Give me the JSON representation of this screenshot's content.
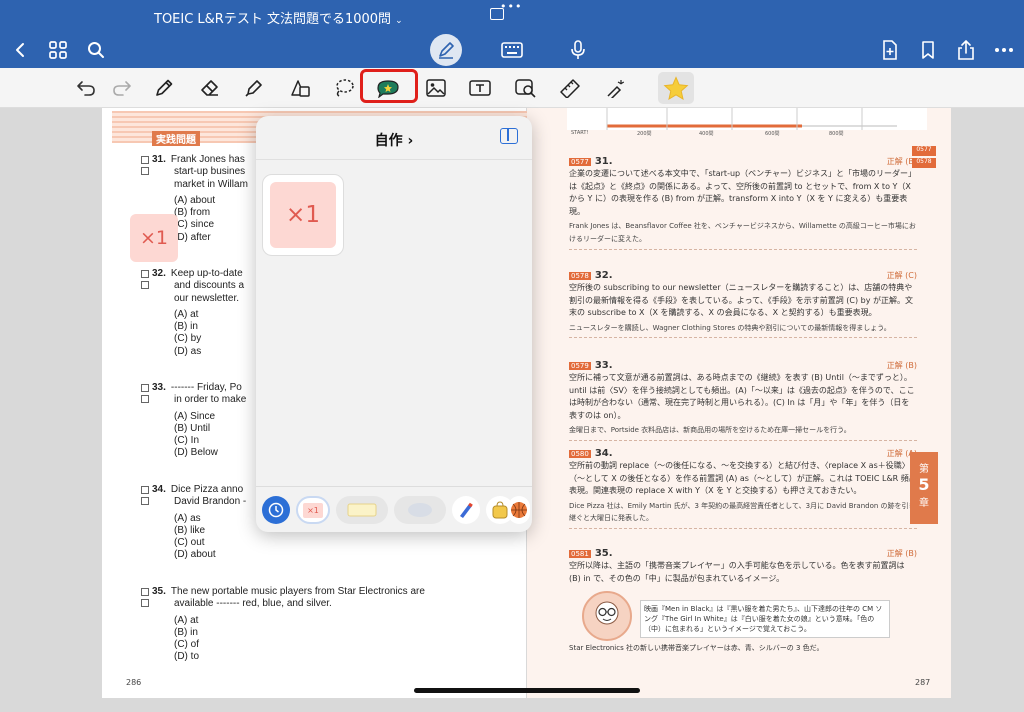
{
  "window": {
    "title": "TOEIC L&Rテスト 文法問題でる1000問",
    "title_chevron": "⌄"
  },
  "popover": {
    "title": "自作 ›",
    "sticker_label": "×1",
    "category_x1_label": "×1"
  },
  "canvas": {
    "floating_sticker_label": "×1"
  },
  "left_page": {
    "section_label": "実践問題",
    "page_number": "286",
    "questions": [
      {
        "num": "31.",
        "lines": [
          "Frank Jones has",
          "start-up busines",
          "market in Willam"
        ],
        "options": [
          "(A) about",
          "(B) from",
          "(C) since",
          "(D) after"
        ]
      },
      {
        "num": "32.",
        "lines": [
          "Keep up-to-date",
          "and discounts a",
          "our newsletter."
        ],
        "options": [
          "(A) at",
          "(B) in",
          "(C) by",
          "(D) as"
        ]
      },
      {
        "num": "33.",
        "lines": [
          "------- Friday, Po",
          "in order to make"
        ],
        "options": [
          "(A) Since",
          "(B) Until",
          "(C) In",
          "(D) Below"
        ]
      },
      {
        "num": "34.",
        "lines": [
          "Dice Pizza anno",
          "David Brandon -"
        ],
        "options": [
          "(A) as",
          "(B) like",
          "(C) out",
          "(D) about"
        ]
      },
      {
        "num": "35.",
        "lines": [
          "The new portable music players from Star Electronics are",
          "available ------- red, blue, and silver."
        ],
        "options": [
          "(A) at",
          "(B) in",
          "(C) of",
          "(D) to"
        ]
      }
    ]
  },
  "right_page": {
    "page_number": "287",
    "timeline_labels": [
      "START!",
      "200問",
      "400問",
      "600問",
      "800問"
    ],
    "side_tabs": [
      "0577",
      "0578"
    ],
    "chapter_tab": {
      "label": "第",
      "num": "5",
      "suffix": "章"
    },
    "entries": [
      {
        "id": "0577",
        "q": "31.",
        "answer": "正解 (B)",
        "text": "企業の変遷について述べる本文中で、「start-up（ベンチャー）ビジネス」と「市場のリーダー」は《起点》と《終点》の関係にある。よって、空所後の前置詞 to とセットで、from X to Y（X から Y に）の表現を作る (B) from が正解。transform X into Y（X を Y に変える）も重要表現。",
        "note": "Frank Jones は、Beansflavor Coffee 社を、ベンチャービジネスから、Willamette の高級コーヒー市場におけるリーダーに変えた。"
      },
      {
        "id": "0578",
        "q": "32.",
        "answer": "正解 (C)",
        "text": "空所後の subscribing to our newsletter（ニュースレターを購読すること）は、店舗の特典や割引の最新情報を得る《手段》を表している。よって、《手段》を示す前置詞 (C) by が正解。文末の subscribe to X（X を購読する、X の会員になる、X と契約する）も重要表現。",
        "note": "ニュースレターを購読し、Wagner Clothing Stores の特典や割引についての最新情報を得ましょう。"
      },
      {
        "id": "0579",
        "q": "33.",
        "answer": "正解 (B)",
        "text": "空所に補って文意が通る前置詞は、ある時点までの《継続》を表す (B) Until（〜までずっと）。until は前〈SV〉を伴う接続詞としても頻出。(A)「〜以来」は《過去の起点》を伴うので、ここは時制が合わない（通常、現在完了時制と用いられる）。(C) In は「月」や「年」を伴う（日を表すのは on）。",
        "note": "金曜日まで、Portside 衣料品店は、新商品用の場所を空けるため在庫一掃セールを行う。"
      },
      {
        "id": "0580",
        "q": "34.",
        "answer": "正解 (A)",
        "text": "空所前の動詞 replace（〜の後任になる、〜を交換する）と結び付き、〈replace X as＋役職〉（〜として X の後任となる）を作る前置詞 (A) as（〜として）が正解。これは TOEIC L&R 頻出表現。関連表現の replace X with Y（X を Y と交換する）も押さえておきたい。",
        "note": "Dice Pizza 社は、Emily Martin 氏が、3 年契約の最高経営責任者として、3月に David Brandon の跡を引き継ぐと大曜日に発表した。"
      },
      {
        "id": "0581",
        "q": "35.",
        "answer": "正解 (B)",
        "text": "空所以降は、主語の「携帯音楽プレイヤー」の入手可能な色を示している。色を表す前置詞は (B) in で、その色の「中」に製品が包まれているイメージ。",
        "note": "Star Electronics 社の新しい携帯音楽プレイヤーは赤、青、シルバーの 3 色だ。"
      }
    ],
    "tip_text": "映画『Men in Black』は『黒い服を着た男たち』、山下達郎の往年の CM ソング『The Girl In White』は『白い服を着た女の娘』という意味。「色の（中）に包まれる」というイメージで覚えておこう。"
  }
}
